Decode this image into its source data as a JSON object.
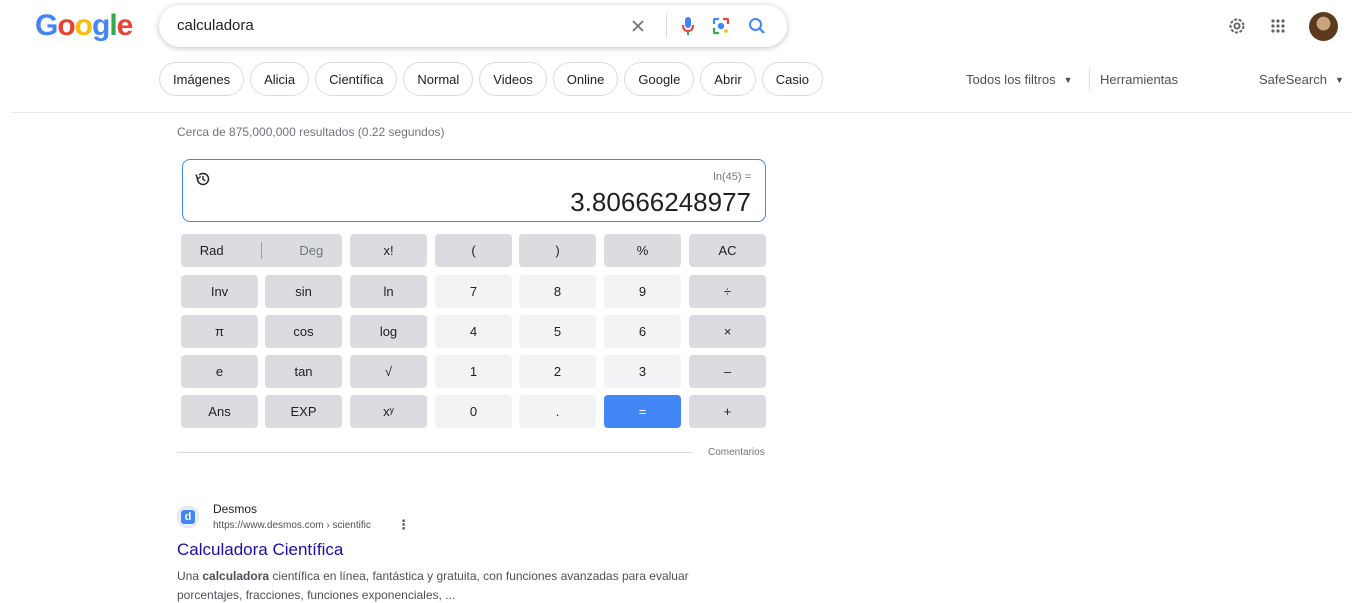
{
  "header": {
    "logo_text": "Google",
    "search": {
      "query": "calculadora"
    },
    "icons": [
      "close-icon",
      "mic-icon",
      "lens-icon",
      "search-icon",
      "settings-icon",
      "apps-icon"
    ]
  },
  "chips": [
    "Imágenes",
    "Alicia",
    "Científica",
    "Normal",
    "Videos",
    "Online",
    "Google",
    "Abrir",
    "Casio"
  ],
  "tools": {
    "all_filters": "Todos los filtros",
    "tools": "Herramientas",
    "safesearch": "SafeSearch"
  },
  "results_count": "Cerca de 875,000,000 resultados (0.22 segundos)",
  "calculator": {
    "expression": "ln(45) =",
    "result": "3.80666248977",
    "rad_label": "Rad",
    "deg_label": "Deg",
    "keys": [
      [
        "x!",
        "(",
        ")",
        "%",
        "AC"
      ],
      [
        "Inv",
        "sin",
        "ln",
        "7",
        "8",
        "9",
        "÷"
      ],
      [
        "π",
        "cos",
        "log",
        "4",
        "5",
        "6",
        "×"
      ],
      [
        "e",
        "tan",
        "√",
        "1",
        "2",
        "3",
        "–"
      ],
      [
        "Ans",
        "EXP",
        "xʸ",
        "0",
        ".",
        "=",
        "+"
      ]
    ],
    "feedback": "Comentarios"
  },
  "result": {
    "favicon_letter": "d",
    "site_name": "Desmos",
    "url": "https://www.desmos.com › scientific",
    "title": "Calculadora Científica",
    "snippet_bold": "calculadora",
    "snippet_pre": "Una ",
    "snippet_post": " científica en línea, fantástica y gratuita, con funciones avanzadas para evaluar porcentajes, fracciones, funciones exponenciales, ..."
  }
}
